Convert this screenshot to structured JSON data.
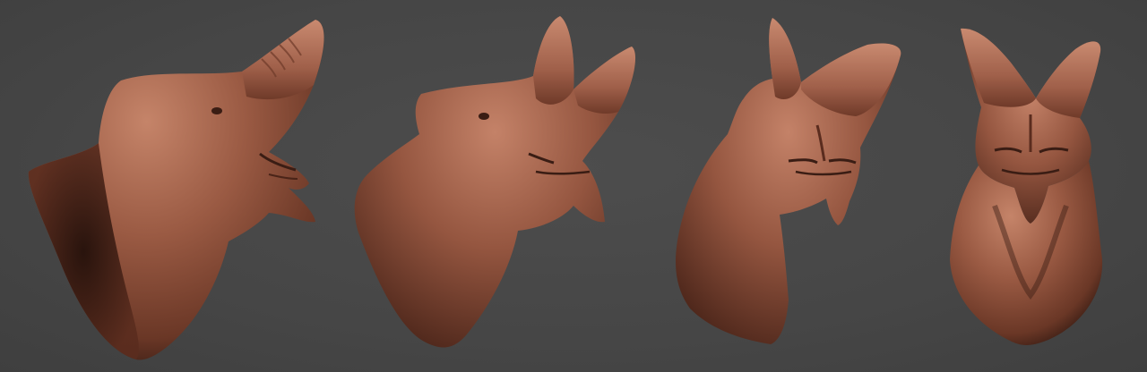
{
  "scene": {
    "background": "#474747",
    "clay": {
      "base": "#9a5a43",
      "light": "#c58469",
      "dark": "#3a1d14"
    },
    "views": [
      {
        "id": "view-1"
      },
      {
        "id": "view-2"
      },
      {
        "id": "view-3"
      },
      {
        "id": "view-4"
      }
    ]
  }
}
